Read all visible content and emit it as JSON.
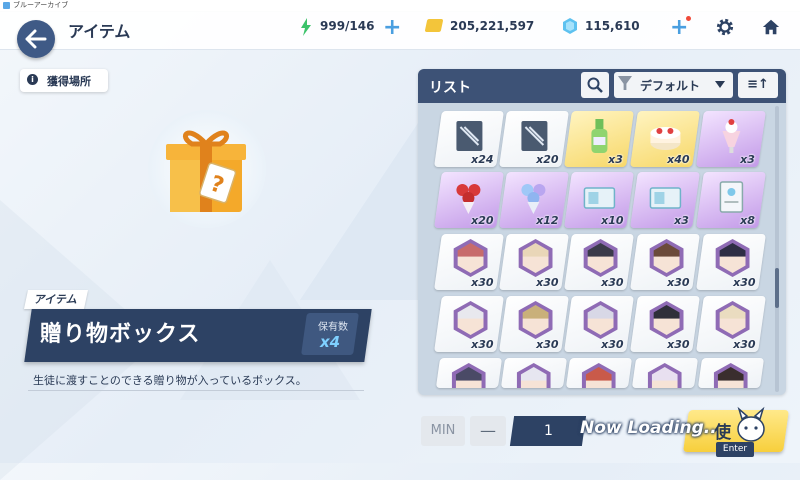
{
  "window": {
    "title": "ブルーアーカイブ"
  },
  "header": {
    "title": "アイテム",
    "ap": "999/146",
    "credits": "205,221,597",
    "gems": "115,610"
  },
  "detail": {
    "source_label": "獲得場所",
    "category": "アイテム",
    "name": "贈り物ボックス",
    "owned_label": "保有数",
    "owned_count": "x4",
    "description": "生徒に渡すことのできる贈り物が入っているボックス。"
  },
  "list": {
    "title": "リスト",
    "sort": "デフォルト",
    "order_label": "≡↑",
    "items": [
      {
        "icon": "blueprint-icon",
        "qty": "x24",
        "rarity": "white"
      },
      {
        "icon": "blueprint-icon",
        "qty": "x20",
        "rarity": "white"
      },
      {
        "icon": "ramune-bottle-icon",
        "qty": "x3",
        "rarity": "gold"
      },
      {
        "icon": "cake-icon",
        "qty": "x40",
        "rarity": "gold"
      },
      {
        "icon": "parfait-icon",
        "qty": "x3",
        "rarity": "purple"
      },
      {
        "icon": "rose-bouquet-icon",
        "qty": "x20",
        "rarity": "purple"
      },
      {
        "icon": "blue-bouquet-icon",
        "qty": "x12",
        "rarity": "purple"
      },
      {
        "icon": "ticket-icon",
        "qty": "x10",
        "rarity": "purple"
      },
      {
        "icon": "ticket-icon",
        "qty": "x3",
        "rarity": "purple"
      },
      {
        "icon": "document-icon",
        "qty": "x8",
        "rarity": "purple"
      },
      {
        "icon": "student-eleph-icon",
        "qty": "x30",
        "rarity": "white"
      },
      {
        "icon": "student-eleph-icon",
        "qty": "x30",
        "rarity": "white"
      },
      {
        "icon": "student-eleph-icon",
        "qty": "x30",
        "rarity": "white"
      },
      {
        "icon": "student-eleph-icon",
        "qty": "x30",
        "rarity": "white"
      },
      {
        "icon": "student-eleph-icon",
        "qty": "x30",
        "rarity": "white"
      },
      {
        "icon": "student-eleph-icon",
        "qty": "x30",
        "rarity": "white"
      },
      {
        "icon": "student-eleph-icon",
        "qty": "x30",
        "rarity": "white"
      },
      {
        "icon": "student-eleph-icon",
        "qty": "x30",
        "rarity": "white"
      },
      {
        "icon": "student-eleph-icon",
        "qty": "x30",
        "rarity": "white"
      },
      {
        "icon": "student-eleph-icon",
        "qty": "x30",
        "rarity": "white"
      },
      {
        "icon": "student-eleph-icon",
        "qty": "",
        "rarity": "white"
      },
      {
        "icon": "student-eleph-icon",
        "qty": "",
        "rarity": "white"
      },
      {
        "icon": "student-eleph-icon",
        "qty": "",
        "rarity": "white"
      },
      {
        "icon": "student-eleph-icon",
        "qty": "",
        "rarity": "white"
      },
      {
        "icon": "student-eleph-icon",
        "qty": "",
        "rarity": "white"
      }
    ],
    "hair_colors": [
      "#c76b6b",
      "#e9d6b8",
      "#3b3b4a",
      "#6b4a3a",
      "#2e2e44",
      "#e8e8ee",
      "#c9b07a",
      "#d8d8e6",
      "#2f2f3a",
      "#eadcc0",
      "#4a4a66",
      "#e6e6f0",
      "#c95a4a",
      "#e8e0f0",
      "#3a2e2e"
    ]
  },
  "footer": {
    "min_label": "MIN",
    "minus_label": "—",
    "quantity": "1",
    "use_label": "使",
    "loading_text": "Now Loading..",
    "enter_label": "Enter"
  },
  "colors": {
    "accent": "#2d4264",
    "highlight": "#f7cf3c",
    "plus": "#4a9fe0"
  }
}
